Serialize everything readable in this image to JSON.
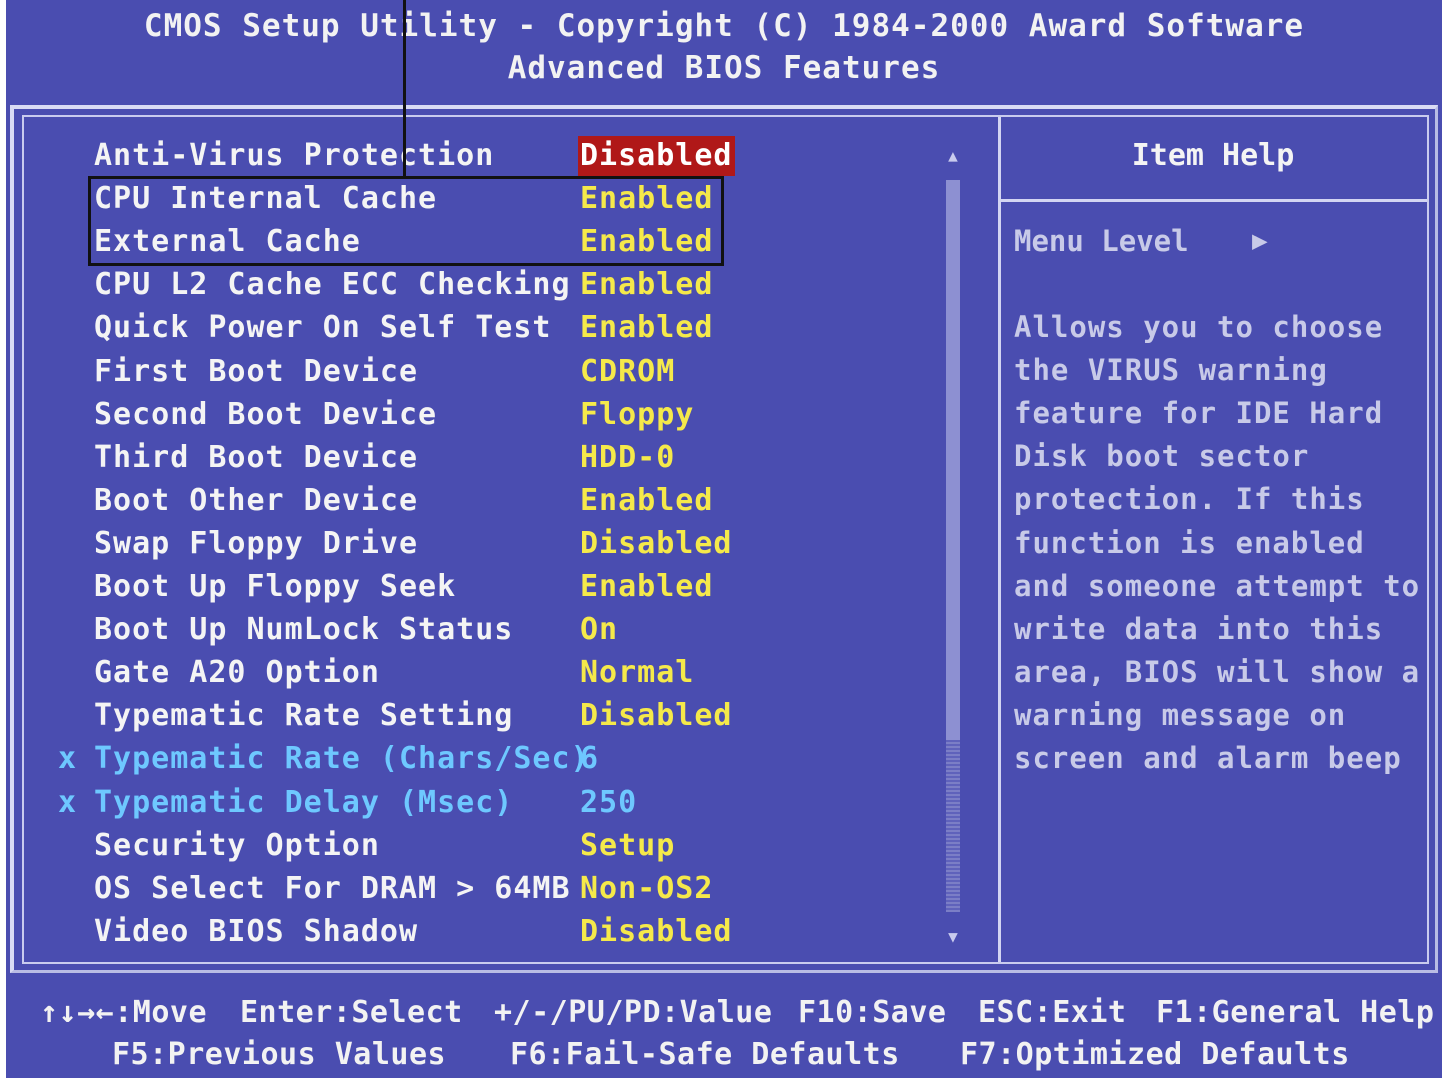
{
  "header": {
    "title": "CMOS Setup Utility - Copyright (C) 1984-2000 Award Software",
    "subtitle": "Advanced BIOS Features"
  },
  "settings": [
    {
      "mark": "",
      "label": "Anti-Virus Protection",
      "value": "Disabled"
    },
    {
      "mark": "",
      "label": "CPU Internal Cache",
      "value": "Enabled"
    },
    {
      "mark": "",
      "label": "External Cache",
      "value": "Enabled"
    },
    {
      "mark": "",
      "label": "CPU L2 Cache ECC Checking",
      "value": "Enabled"
    },
    {
      "mark": "",
      "label": "Quick Power On Self Test",
      "value": "Enabled"
    },
    {
      "mark": "",
      "label": "First Boot Device",
      "value": "CDROM"
    },
    {
      "mark": "",
      "label": "Second Boot Device",
      "value": "Floppy"
    },
    {
      "mark": "",
      "label": "Third Boot Device",
      "value": "HDD-0"
    },
    {
      "mark": "",
      "label": "Boot Other Device",
      "value": "Enabled"
    },
    {
      "mark": "",
      "label": "Swap Floppy Drive",
      "value": "Disabled"
    },
    {
      "mark": "",
      "label": "Boot Up Floppy Seek",
      "value": "Enabled"
    },
    {
      "mark": "",
      "label": "Boot Up NumLock Status",
      "value": "On"
    },
    {
      "mark": "",
      "label": "Gate A20 Option",
      "value": "Normal"
    },
    {
      "mark": "",
      "label": "Typematic Rate Setting",
      "value": "Disabled"
    },
    {
      "mark": "x",
      "label": "Typematic Rate (Chars/Sec)",
      "value": "6"
    },
    {
      "mark": "x",
      "label": "Typematic Delay (Msec)",
      "value": "250"
    },
    {
      "mark": "",
      "label": "Security Option",
      "value": "Setup"
    },
    {
      "mark": "",
      "label": "OS Select For DRAM > 64MB",
      "value": "Non-OS2"
    },
    {
      "mark": "",
      "label": "Video BIOS Shadow",
      "value": "Disabled"
    }
  ],
  "help": {
    "title": "Item Help",
    "menu_level": "Menu Level",
    "lines": [
      "Allows you to choose",
      "the VIRUS warning",
      "feature for IDE Hard",
      "Disk boot sector",
      "protection. If this",
      "function is enabled",
      "and someone attempt to",
      "write data into this",
      "area, BIOS will show a",
      "warning message on",
      "screen and alarm beep"
    ]
  },
  "footer": {
    "move": "↑↓→←:Move",
    "select": "Enter:Select",
    "value": "+/-/PU/PD:Value",
    "save": "F10:Save",
    "exit": "ESC:Exit",
    "help": "F1:General Help",
    "previous": "F5:Previous Values",
    "failsafe": "F6:Fail-Safe Defaults",
    "optimized": "F7:Optimized Defaults"
  },
  "icons": {
    "scroll_up": "scroll-up-arrow-icon",
    "scroll_down": "scroll-down-arrow-icon",
    "menu_arrow": "right-triangle-icon"
  },
  "colors": {
    "background": "#4a4db0",
    "value_text": "#f5e94a",
    "selected_value_bg": "#b01818",
    "disabled_text": "#6ec8ff"
  }
}
